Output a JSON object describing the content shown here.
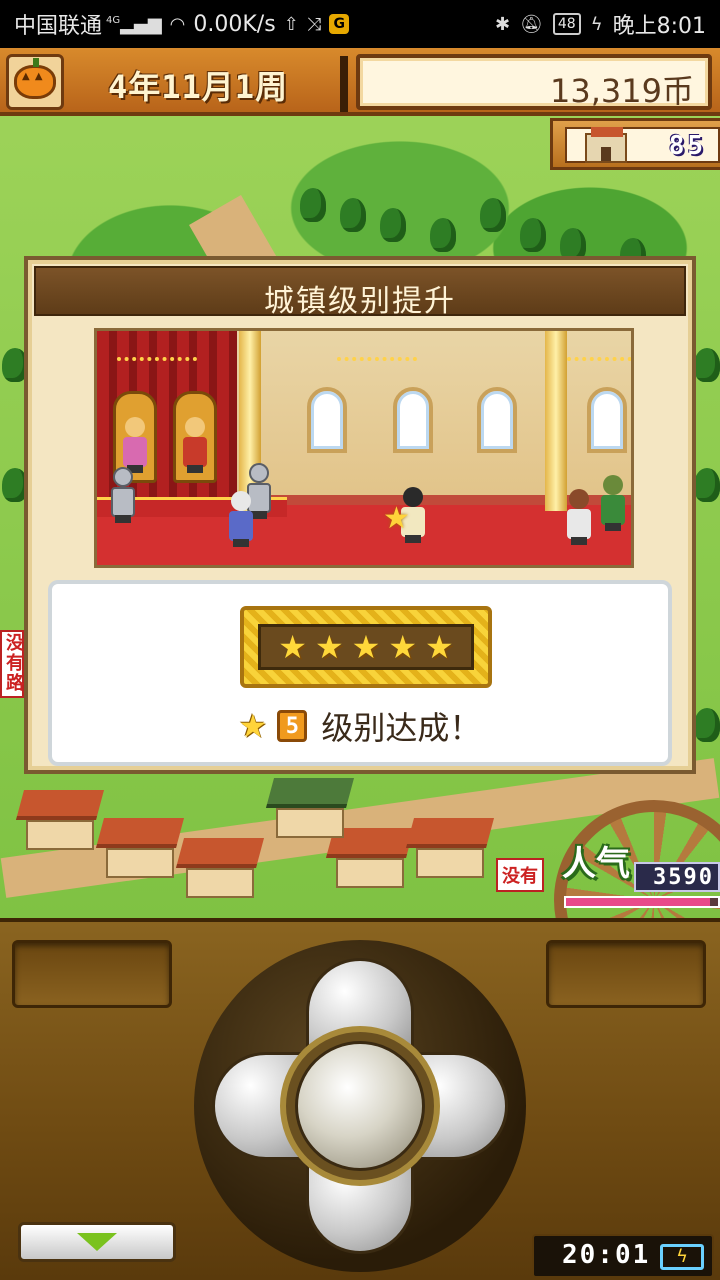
{
  "status_bar": {
    "carrier": "中国联通",
    "network_type": "4G",
    "speed": "0.00K/s",
    "battery": "48",
    "time": "晚上8:01"
  },
  "hud": {
    "date": "4年11月1周",
    "money": "13,319币",
    "town_rank": "85"
  },
  "popup": {
    "title": "城镇级别提升",
    "stars_filled": 5,
    "level_number": "5",
    "level_text": "级别达成！"
  },
  "popularity": {
    "label": "人气",
    "value": "3590",
    "bar_fraction": 0.95
  },
  "road_signs": {
    "left": "没有路",
    "right": "没有"
  },
  "controller": {
    "clock": "20:01"
  },
  "icons": {
    "menu": "pumpkin-icon",
    "town": "castle-icon",
    "toggle": "down-triangle-icon",
    "battery": "battery-charging-icon"
  },
  "colors": {
    "hud_orange": "#d88a2c",
    "star_yellow": "#ffd43a",
    "popularity_bar": "#e84a8a",
    "controller_brown": "#8a6420"
  }
}
